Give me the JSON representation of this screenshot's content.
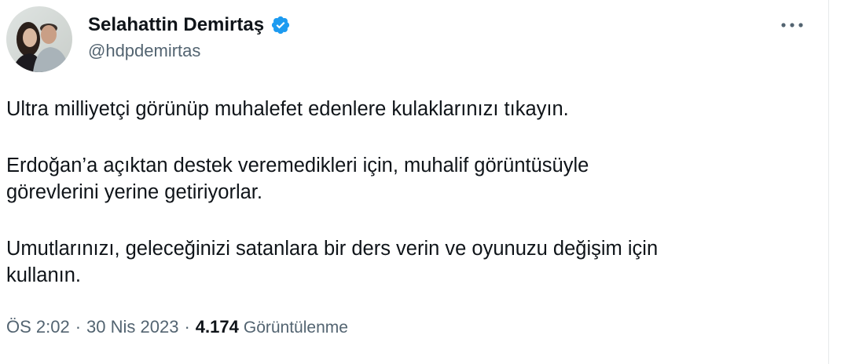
{
  "author": {
    "display_name": "Selahattin Demirtaş",
    "handle": "@hdpdemirtas",
    "verified": true,
    "verified_color": "#1d9bf0"
  },
  "tweet": {
    "paragraphs": [
      "Ultra milliyetçi görünüp muhalefet edenlere kulaklarınızı tıkayın.",
      "Erdoğan’a açıktan destek veremedikleri için, muhalif görüntüsüyle\ngörevlerini yerine getiriyorlar.",
      "Umutlarınızı, geleceğinizi satanlara bir ders verin ve oyunuzu değişim için\nkullanın."
    ]
  },
  "meta": {
    "time": "ÖS 2:02",
    "separator": "·",
    "date": "30 Nis 2023",
    "views_count": "4.174",
    "views_label": "Görüntülenme"
  },
  "icons": {
    "more": "more-horizontal-icon",
    "verified": "verified-badge-icon"
  },
  "colors": {
    "text_primary": "#0f1419",
    "text_secondary": "#536471"
  }
}
